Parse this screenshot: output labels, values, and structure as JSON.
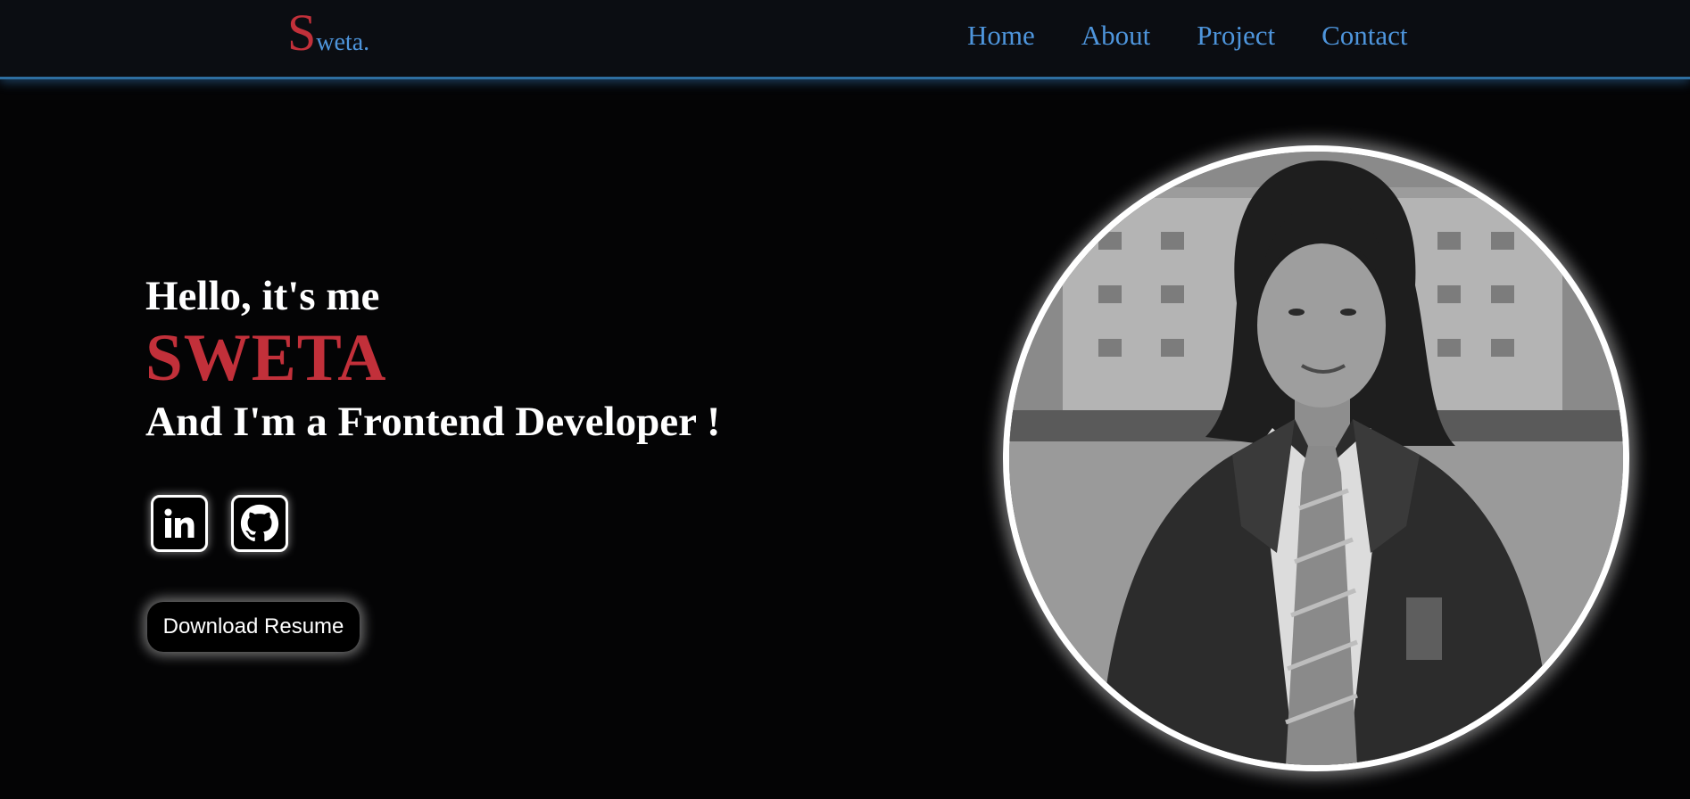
{
  "header": {
    "logo_initial": "S",
    "logo_rest": "weta.",
    "nav": [
      "Home",
      "About",
      "Project",
      "Contact"
    ]
  },
  "hero": {
    "greeting": "Hello, it's me",
    "name": "SWETA",
    "tagline": "And I'm a Frontend Developer !",
    "resume_button": "Download Resume"
  },
  "socials": [
    {
      "icon": "linkedin-icon"
    },
    {
      "icon": "github-icon"
    }
  ],
  "colors": {
    "background": "#040405",
    "header_bg": "#0b0d12",
    "accent_red": "#c2303a",
    "nav_blue": "#4e95dc",
    "white": "#ffffff"
  }
}
